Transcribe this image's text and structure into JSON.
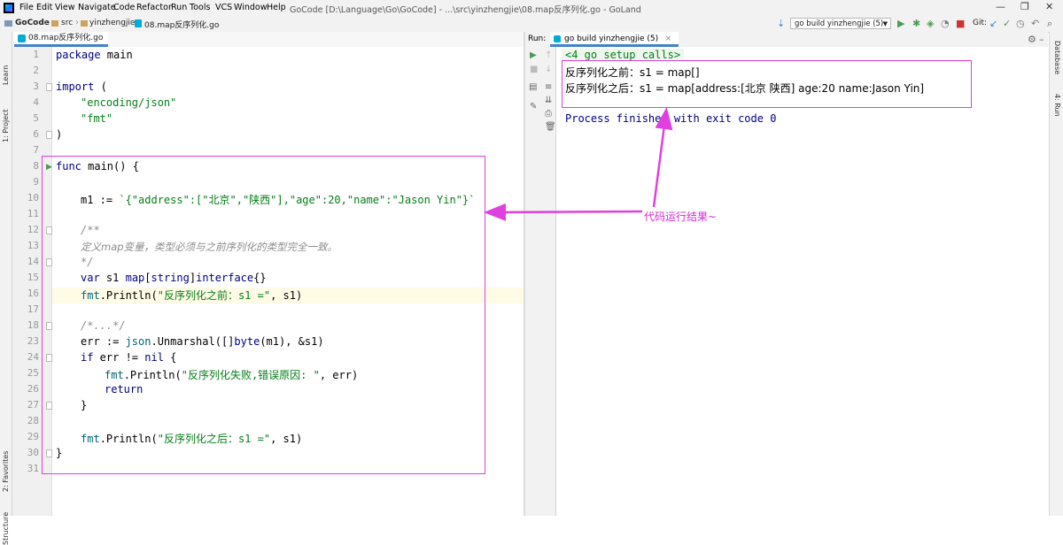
{
  "menubar": {
    "items": [
      "File",
      "Edit",
      "View",
      "Navigate",
      "Code",
      "Refactor",
      "Run",
      "Tools",
      "VCS",
      "Window",
      "Help"
    ],
    "title": "GoCode [D:\\Language\\Go\\GoCode] - ...\\src\\yinzhengjie\\08.map反序列化.go - GoLand"
  },
  "breadcrumb": [
    "GoCode",
    "src",
    "yinzhengjie",
    "08.map反序列化.go"
  ],
  "run_config": "go build yinzhengjie (5)",
  "git_label": "Git:",
  "left_strip": {
    "learn": "Learn",
    "project": "1: Project",
    "favorites": "2: Favorites",
    "structure": "Structure"
  },
  "right_strip": {
    "database": "Database",
    "run": "4: Run"
  },
  "editor_tab": "08.map反序列化.go",
  "line_numbers": [
    "1",
    "2",
    "3",
    "4",
    "5",
    "6",
    "7",
    "8",
    "9",
    "10",
    "11",
    "12",
    "13",
    "14",
    "15",
    "16",
    "17",
    "18",
    "23",
    "24",
    "25",
    "26",
    "27",
    "28",
    "29",
    "30",
    "31"
  ],
  "code": {
    "l1_kw": "package",
    "l1_rest": " main",
    "l3_kw": "import",
    "l3_rest": " (",
    "l4": "\"encoding/json\"",
    "l5": "\"fmt\"",
    "l6": ")",
    "l8_kw": "func",
    "l8_rest": " main() {",
    "l10_pre": "m1 := ",
    "l10_str": "`{\"address\":[\"北京\",\"陕西\"],\"age\":20,\"name\":\"Jason Yin\"}`",
    "l12": "/**",
    "l13": "定义map变量，类型必须与之前序列化的类型完全一致。",
    "l14": "*/",
    "l15_kw": "var",
    "l15_rest": " s1 ",
    "l15_kw2": "map",
    "l15_rest2": "[",
    "l15_kw3": "string",
    "l15_rest3": "]",
    "l15_kw4": "interface",
    "l15_rest4": "{}",
    "l16_pk": "fmt",
    "l16_a": ".Println(",
    "l16_str": "\"反序列化之前：s1 =\"",
    "l16_b": ", s1)",
    "l17": "",
    "l18": "/*...*/",
    "l23_a": "err := ",
    "l23_pk": "json",
    "l23_b": ".Unmarshal([]",
    "l23_kw": "byte",
    "l23_c": "(m1), &s1)",
    "l24_kw": "if",
    "l24_a": " err != ",
    "l24_kw2": "nil",
    "l24_b": " {",
    "l25_pk": "fmt",
    "l25_a": ".Println(",
    "l25_str": "\"反序列化失败,错误原因: \"",
    "l25_b": ", err)",
    "l26_kw": "return",
    "l27": "}",
    "l29_pk": "fmt",
    "l29_a": ".Println(",
    "l29_str": "\"反序列化之后：s1 =\"",
    "l29_b": ", s1)",
    "l30": "}"
  },
  "run_panel": {
    "label": "Run:",
    "tab": "go build yinzhengjie (5)",
    "output": [
      "<4 go setup calls>",
      "反序列化之前：s1 = map[]",
      "反序列化之后：s1 = map[address:[北京 陕西] age:20 name:Jason Yin]",
      "",
      "Process finished with exit code 0"
    ]
  },
  "annotation": "代码运行结果~",
  "colors": {
    "annotation": "#e040e0",
    "keyword": "#000080",
    "string": "#067d17",
    "comment": "#8c8c8c"
  }
}
